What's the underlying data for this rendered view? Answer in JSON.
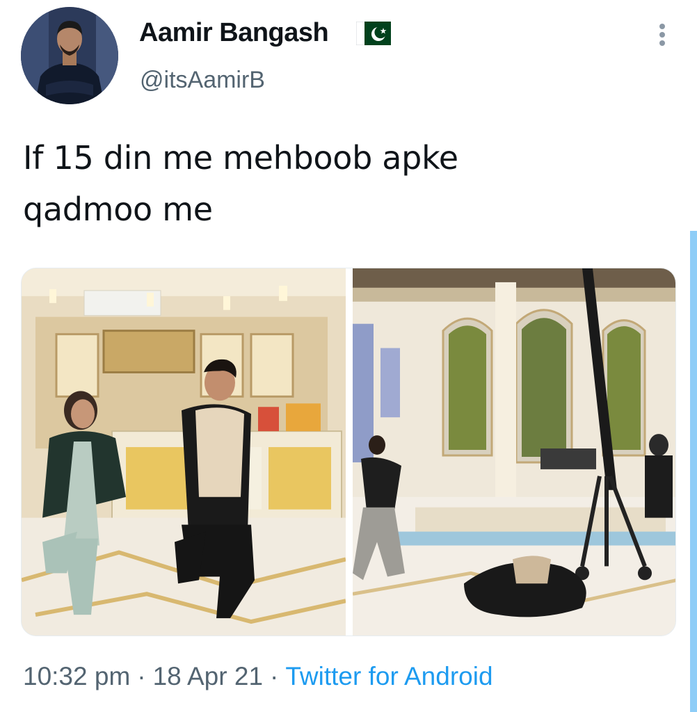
{
  "tweet": {
    "author_name": "Aamir Bangash",
    "handle": "@itsAamirB",
    "text": "If 15 din me mehboob apke\nqadmoo me",
    "time": "10:32 pm",
    "separator": "·",
    "date": "18 Apr 21",
    "source": "Twitter for Android"
  },
  "icons": {
    "flag": "pakistan-flag-icon",
    "more": "more-vertical-icon"
  },
  "colors": {
    "text": "#0f1419",
    "secondary": "#536471",
    "link": "#1d9bf0",
    "flag_green": "#01411c"
  }
}
